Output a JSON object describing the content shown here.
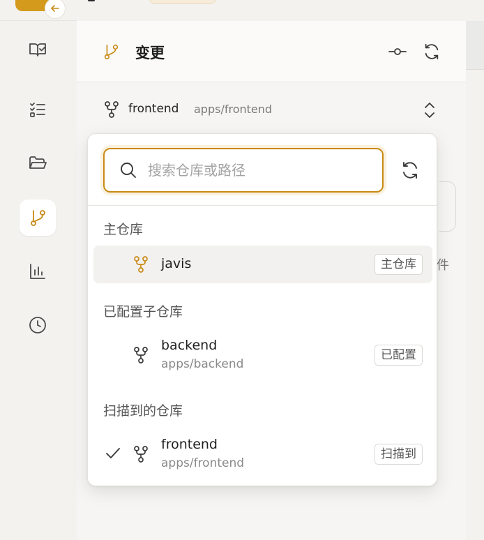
{
  "header": {
    "title": "变更"
  },
  "repo_selector": {
    "name": "frontend",
    "path": "apps/frontend"
  },
  "background": {
    "partial_text": "件"
  },
  "dropdown": {
    "search_placeholder": "搜索仓库或路径",
    "search_value": "",
    "sections": [
      {
        "label": "主仓库",
        "items": [
          {
            "name": "javis",
            "path": "",
            "badge": "主仓库",
            "selected": false,
            "hovered": true
          }
        ]
      },
      {
        "label": "已配置子仓库",
        "items": [
          {
            "name": "backend",
            "path": "apps/backend",
            "badge": "已配置",
            "selected": false
          }
        ]
      },
      {
        "label": "扫描到的仓库",
        "items": [
          {
            "name": "frontend",
            "path": "apps/frontend",
            "badge": "扫描到",
            "selected": true
          }
        ]
      }
    ]
  },
  "icons": {
    "back": "arrow-left-icon",
    "rail": [
      "book-check-icon",
      "checklist-icon",
      "folder-open-icon",
      "git-branch-icon",
      "bar-chart-icon",
      "clock-icon"
    ],
    "active_rail": "git-branch-icon"
  },
  "colors": {
    "accent": "#c98a16",
    "icon_gray": "#4a4a4a"
  }
}
